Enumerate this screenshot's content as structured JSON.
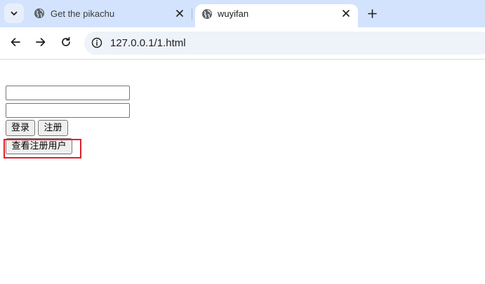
{
  "browser": {
    "tabs": [
      {
        "title": "Get the pikachu",
        "active": false
      },
      {
        "title": "wuyifan",
        "active": true
      }
    ],
    "address_bar": {
      "url": "127.0.0.1/1.html"
    }
  },
  "page": {
    "username_input": {
      "value": "",
      "placeholder": ""
    },
    "password_input": {
      "value": "",
      "placeholder": ""
    },
    "login_button_label": "登录",
    "register_button_label": "注册",
    "view_users_button_label": "查看注册用户"
  },
  "colors": {
    "tabstrip_bg": "#d3e3fd",
    "omnibox_bg": "#eef2f9",
    "highlight_border": "#e0202a"
  },
  "icons": {
    "tab_search": "chevron-down-icon",
    "favicon": "globe-icon",
    "tab_close": "close-icon",
    "new_tab": "plus-icon",
    "back": "arrow-left-icon",
    "forward": "arrow-right-icon",
    "reload": "reload-icon",
    "site_info": "info-icon"
  }
}
